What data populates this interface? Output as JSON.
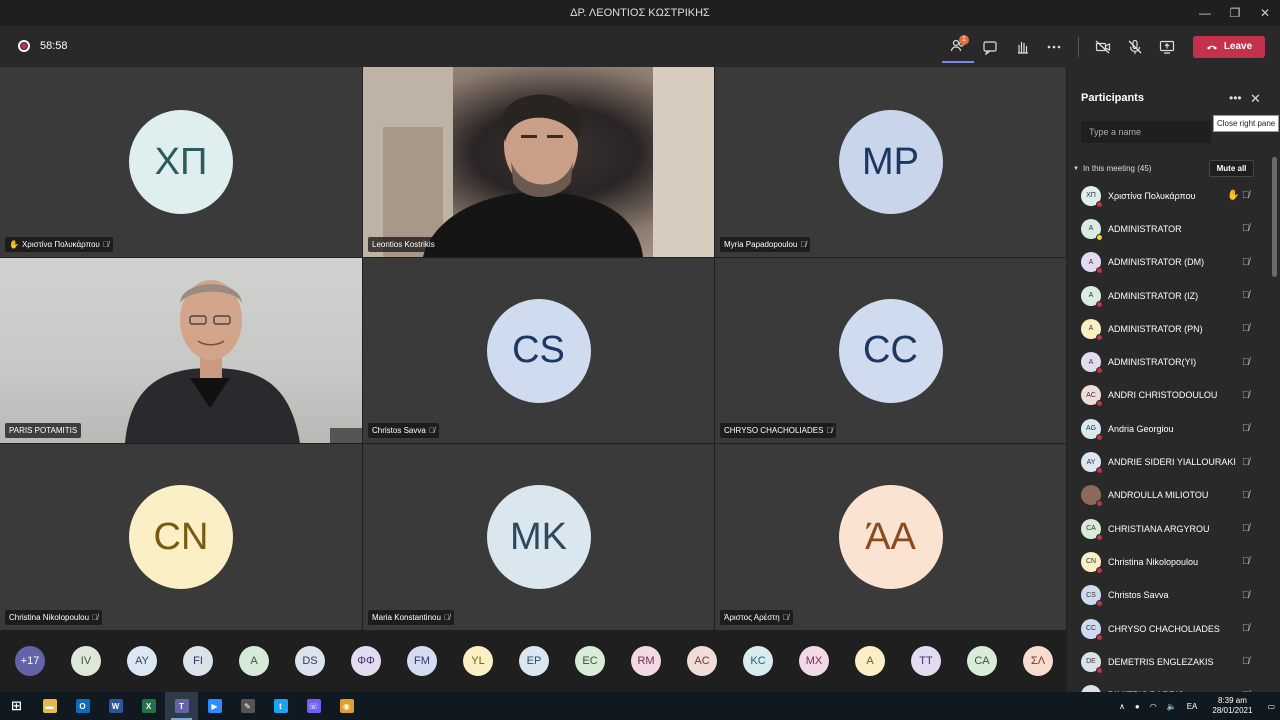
{
  "window": {
    "title": "ΔΡ. ΛΕΟΝΤΙΟΣ ΚΩΣΤΡΙΚΗΣ",
    "minimize": "—",
    "restore": "❐",
    "close": "✕"
  },
  "toolbar": {
    "timer": "58:58",
    "participants_badge": "1",
    "leave_label": "Leave"
  },
  "tiles": [
    {
      "name": "Χριστίνα Πολυκάρπου",
      "initials": "ΧΠ",
      "bg": "#dfeff0",
      "fg": "#2b5a5f",
      "hand": true
    },
    {
      "name": "Leontios Kostrikis",
      "video": true
    },
    {
      "name": "Myria Papadopoulou",
      "initials": "MP",
      "bg": "#c9d5ea",
      "fg": "#1d3765"
    },
    {
      "name": "PARIS POTAMITIS",
      "video": true
    },
    {
      "name": "Christos Savva",
      "initials": "CS",
      "bg": "#cfdbee",
      "fg": "#1d3765"
    },
    {
      "name": "CHRYSO CHACHOLIADES",
      "initials": "CC",
      "bg": "#cfdbee",
      "fg": "#1d3765"
    },
    {
      "name": "Christina Nikolopoulou",
      "initials": "CN",
      "bg": "#fbefc6",
      "fg": "#7a5a10"
    },
    {
      "name": "Maria Konstantinou",
      "initials": "MK",
      "bg": "#dbe7ee",
      "fg": "#2b4a5f"
    },
    {
      "name": "Άριστος Αρέστη",
      "initials": "ΆΑ",
      "bg": "#fbe3d2",
      "fg": "#8a4a20"
    }
  ],
  "strip": [
    {
      "t": "+17",
      "bg": "#6264a7",
      "fg": "#fff"
    },
    {
      "t": "IV",
      "bg": "#dfe8d8",
      "fg": "#3a5a2a"
    },
    {
      "t": "AY",
      "bg": "#dbe7f2",
      "fg": "#2b4a6f"
    },
    {
      "t": "FI",
      "bg": "#dbe2ea",
      "fg": "#2b3a5f"
    },
    {
      "t": "A",
      "bg": "#d5ead8",
      "fg": "#2b5a3a"
    },
    {
      "t": "DS",
      "bg": "#dde3ee",
      "fg": "#2b3a5f"
    },
    {
      "t": "ΦΦ",
      "bg": "#e3dcf0",
      "fg": "#4a2b7a"
    },
    {
      "t": "FM",
      "bg": "#d3dcf0",
      "fg": "#2b3a7a"
    },
    {
      "t": "YL",
      "bg": "#fbefc6",
      "fg": "#7a5a10"
    },
    {
      "t": "EP",
      "bg": "#dbe7f0",
      "fg": "#2b4a6f"
    },
    {
      "t": "EC",
      "bg": "#d8ecd8",
      "fg": "#2b5a2b"
    },
    {
      "t": "RM",
      "bg": "#f2d9e3",
      "fg": "#7a2b4a"
    },
    {
      "t": "AC",
      "bg": "#f0dcd8",
      "fg": "#6f3a2b"
    },
    {
      "t": "KC",
      "bg": "#d8ecf0",
      "fg": "#2b5a6f"
    },
    {
      "t": "MX",
      "bg": "#f2d9e8",
      "fg": "#7a2b5a"
    },
    {
      "t": "A",
      "bg": "#fbefc6",
      "fg": "#7a5a10"
    },
    {
      "t": "TT",
      "bg": "#e3dcf0",
      "fg": "#4a2b7a"
    },
    {
      "t": "CA",
      "bg": "#d8ecd8",
      "fg": "#2b5a2b"
    },
    {
      "t": "ΣΛ",
      "bg": "#f8dcd0",
      "fg": "#7a3a20"
    }
  ],
  "pane": {
    "title": "Participants",
    "more": "•••",
    "close": "✕",
    "tooltip": "Close right pane",
    "search_placeholder": "Type a name",
    "section": "In this meeting (45)",
    "mute_all": "Mute all",
    "participants": [
      {
        "name": "Χριστίνα Πολυκάρπου",
        "initials": "ΧΠ",
        "bg": "#dfeff0",
        "hand": true
      },
      {
        "name": "ADMINISTRATOR",
        "initials": "A",
        "bg": "#d8ecdf",
        "status": "away"
      },
      {
        "name": "ADMINISTRATOR (DM)",
        "initials": "A",
        "bg": "#e3dcf0"
      },
      {
        "name": "ADMINISTRATOR (IZ)",
        "initials": "A",
        "bg": "#d8ecdf"
      },
      {
        "name": "ADMINISTRATOR (PN)",
        "initials": "A",
        "bg": "#fbefc6"
      },
      {
        "name": "ADMINISTRATOR(YI)",
        "initials": "A",
        "bg": "#e3dcf0"
      },
      {
        "name": "ANDRI CHRISTODOULOU",
        "initials": "AC",
        "bg": "#f0dcd8"
      },
      {
        "name": "Andria Georgiou",
        "initials": "AG",
        "bg": "#d8ecf0"
      },
      {
        "name": "ANDRIE SIDERI YIALLOURAKI",
        "initials": "AY",
        "bg": "#dbe7f2"
      },
      {
        "name": "ANDROULLA MILIOTOU",
        "initials": "",
        "bg": "#8a6a5a"
      },
      {
        "name": "CHRISTIANA ARGYROU",
        "initials": "CA",
        "bg": "#d8ecd8"
      },
      {
        "name": "Christina Nikolopoulou",
        "initials": "CN",
        "bg": "#fbefc6"
      },
      {
        "name": "Christos Savva",
        "initials": "CS",
        "bg": "#cfdbee"
      },
      {
        "name": "CHRYSO CHACHOLIADES",
        "initials": "CC",
        "bg": "#cfdbee"
      },
      {
        "name": "DEMETRIS ENGLEZAKIS",
        "initials": "DE",
        "bg": "#dbe2ea"
      },
      {
        "name": "DIMITRIS DARRIS",
        "initials": "DD",
        "bg": "#dbe2ea"
      }
    ]
  },
  "taskbar": {
    "apps": [
      {
        "t": "⊞",
        "bg": "transparent",
        "name": "start-button"
      },
      {
        "t": "▬",
        "bg": "#e8b84a",
        "name": "file-explorer-icon"
      },
      {
        "t": "O",
        "bg": "#0f6cbd",
        "name": "outlook-icon"
      },
      {
        "t": "W",
        "bg": "#2b579a",
        "name": "word-icon"
      },
      {
        "t": "X",
        "bg": "#217346",
        "name": "excel-icon"
      },
      {
        "t": "T",
        "bg": "#6264a7",
        "name": "teams-icon",
        "active": true
      },
      {
        "t": "▶",
        "bg": "#2d8cff",
        "name": "zoom-icon"
      },
      {
        "t": "✎",
        "bg": "#555",
        "name": "snip-icon"
      },
      {
        "t": "t",
        "bg": "#1da1f2",
        "name": "app-icon"
      },
      {
        "t": "☏",
        "bg": "#7360f2",
        "name": "viber-icon"
      },
      {
        "t": "◉",
        "bg": "#e0a030",
        "name": "chrome-icon"
      }
    ],
    "lang": "EA",
    "time": "8:39 am",
    "date": "28/01/2021"
  }
}
